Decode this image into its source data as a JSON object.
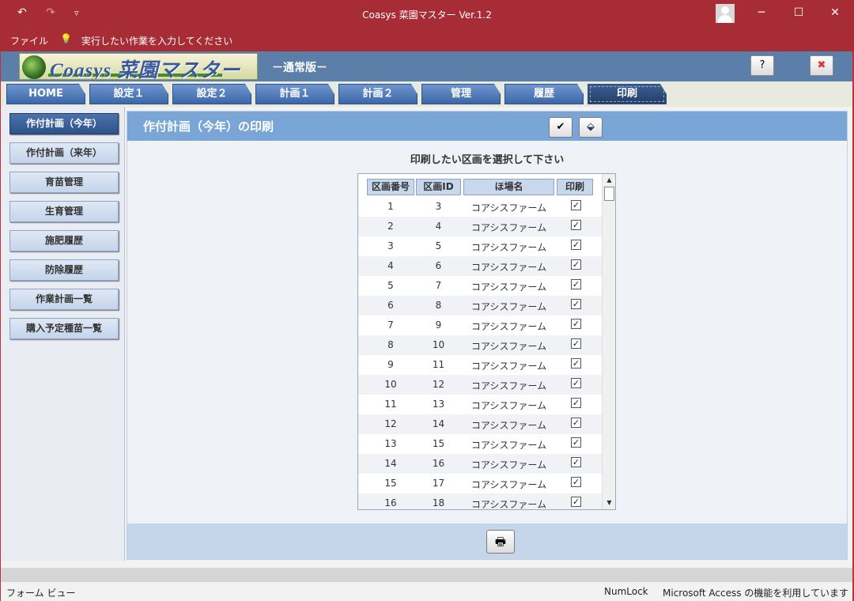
{
  "window": {
    "title": "Coasys 菜園マスター Ver.1.2",
    "undo_icon": "↶",
    "redo_icon": "↷",
    "customize_icon": "▿",
    "minimize": "─",
    "maximize": "☐",
    "close": "✕"
  },
  "ribbon": {
    "file": "ファイル",
    "tell_icon": "💡",
    "tell_me": "実行したい作業を入力してください"
  },
  "header": {
    "logo_text": "Coasys 菜園マスター",
    "edition": "－通常版－",
    "help_icon": "?",
    "close_icon": "✖"
  },
  "tabs": [
    {
      "label": "HOME"
    },
    {
      "label": "設定１"
    },
    {
      "label": "設定２"
    },
    {
      "label": "計画１"
    },
    {
      "label": "計画２"
    },
    {
      "label": "管理"
    },
    {
      "label": "履歴"
    },
    {
      "label": "印刷",
      "active": true
    }
  ],
  "sidebar": {
    "items": [
      {
        "label": "作付計画（今年）",
        "active": true
      },
      {
        "label": "作付計画（来年）"
      },
      {
        "label": "育苗管理"
      },
      {
        "label": "生育管理"
      },
      {
        "label": "施肥履歴"
      },
      {
        "label": "防除履歴"
      },
      {
        "label": "作業計画一覧"
      },
      {
        "label": "購入予定種苗一覧"
      }
    ]
  },
  "panel": {
    "title": "作付計画（今年）の印刷",
    "check_icon": "✔",
    "eraser_icon": "⬙",
    "instruction": "印刷したい区画を選択して下さい",
    "print_icon": "🖶"
  },
  "table": {
    "columns": [
      "区画番号",
      "区画ID",
      "ほ場名",
      "印刷"
    ],
    "rows": [
      {
        "no": "1",
        "id": "3",
        "field": "コアシスファーム",
        "print": true
      },
      {
        "no": "2",
        "id": "4",
        "field": "コアシスファーム",
        "print": true
      },
      {
        "no": "3",
        "id": "5",
        "field": "コアシスファーム",
        "print": true
      },
      {
        "no": "4",
        "id": "6",
        "field": "コアシスファーム",
        "print": true
      },
      {
        "no": "5",
        "id": "7",
        "field": "コアシスファーム",
        "print": true
      },
      {
        "no": "6",
        "id": "8",
        "field": "コアシスファーム",
        "print": true
      },
      {
        "no": "7",
        "id": "9",
        "field": "コアシスファーム",
        "print": true
      },
      {
        "no": "8",
        "id": "10",
        "field": "コアシスファーム",
        "print": true
      },
      {
        "no": "9",
        "id": "11",
        "field": "コアシスファーム",
        "print": true
      },
      {
        "no": "10",
        "id": "12",
        "field": "コアシスファーム",
        "print": true
      },
      {
        "no": "11",
        "id": "13",
        "field": "コアシスファーム",
        "print": true
      },
      {
        "no": "12",
        "id": "14",
        "field": "コアシスファーム",
        "print": true
      },
      {
        "no": "13",
        "id": "15",
        "field": "コアシスファーム",
        "print": true
      },
      {
        "no": "14",
        "id": "16",
        "field": "コアシスファーム",
        "print": true
      },
      {
        "no": "15",
        "id": "17",
        "field": "コアシスファーム",
        "print": true
      },
      {
        "no": "16",
        "id": "18",
        "field": "コアシスファーム",
        "print": true
      }
    ]
  },
  "status": {
    "left": "フォーム ビュー",
    "numlock": "NumLock",
    "right": "Microsoft Access の機能を利用しています"
  },
  "colors": {
    "titlebar": "#a82c36",
    "header": "#5b7fa8",
    "tab": "#3c67a8",
    "panel_head": "#7aa5d7"
  }
}
